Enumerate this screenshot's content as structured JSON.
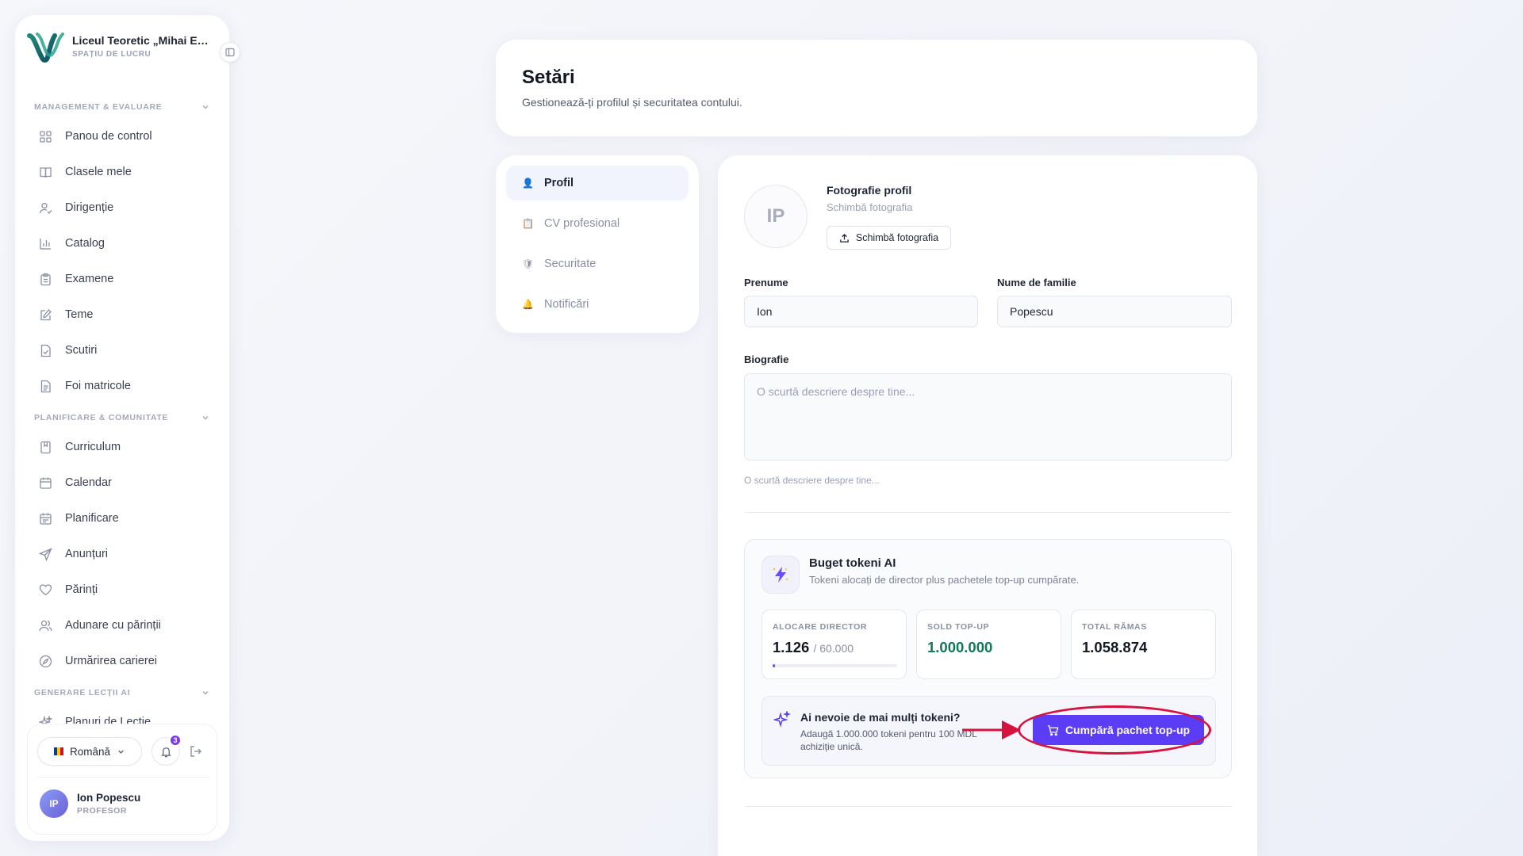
{
  "sidebar": {
    "school_name": "Liceul Teoretic „Mihai Emi...",
    "workspace_label": "SPAȚIU DE LUCRU",
    "sections": [
      {
        "label": "MANAGEMENT & EVALUARE"
      },
      {
        "label": "PLANIFICARE & COMUNITATE"
      },
      {
        "label": "GENERARE LECȚII AI"
      }
    ],
    "items": [
      {
        "label": "Panou de control",
        "icon": "grid-icon"
      },
      {
        "label": "Clasele mele",
        "icon": "book-icon"
      },
      {
        "label": "Dirigenție",
        "icon": "user-check-icon"
      },
      {
        "label": "Catalog",
        "icon": "bar-chart-icon"
      },
      {
        "label": "Examene",
        "icon": "clipboard-icon"
      },
      {
        "label": "Teme",
        "icon": "edit-icon"
      },
      {
        "label": "Scutiri",
        "icon": "file-check-icon"
      },
      {
        "label": "Foi matricole",
        "icon": "file-text-icon"
      },
      {
        "label": "Curriculum",
        "icon": "book-bookmark-icon"
      },
      {
        "label": "Calendar",
        "icon": "calendar-icon"
      },
      {
        "label": "Planificare",
        "icon": "calendar-list-icon"
      },
      {
        "label": "Anunțuri",
        "icon": "send-icon"
      },
      {
        "label": "Părinți",
        "icon": "heart-icon"
      },
      {
        "label": "Adunare cu părinții",
        "icon": "users-icon"
      },
      {
        "label": "Urmărirea carierei",
        "icon": "compass-icon"
      },
      {
        "label": "Planuri de Lecție",
        "icon": "sparkles-icon"
      }
    ],
    "language": "Română",
    "notification_count": "3",
    "user": {
      "initials": "IP",
      "name": "Ion Popescu",
      "role": "PROFESOR"
    }
  },
  "header": {
    "title": "Setări",
    "subtitle": "Gestionează-ți profilul și securitatea contului."
  },
  "settings_nav": [
    {
      "label": "Profil",
      "emoji": "👤",
      "active": true
    },
    {
      "label": "CV profesional",
      "emoji": "📋",
      "active": false
    },
    {
      "label": "Securitate",
      "emoji": "🛡",
      "active": false
    },
    {
      "label": "Notificări",
      "emoji": "🔔",
      "active": false
    }
  ],
  "profile": {
    "initials": "IP",
    "photo_title": "Fotografie profil",
    "photo_subtitle": "Schimbă fotografia",
    "photo_button": "Schimbă fotografia",
    "first_name_label": "Prenume",
    "first_name_value": "Ion",
    "last_name_label": "Nume de familie",
    "last_name_value": "Popescu",
    "bio_label": "Biografie",
    "bio_placeholder": "O scurtă descriere despre tine...",
    "bio_hint": "O scurtă descriere despre tine..."
  },
  "tokens": {
    "title": "Buget tokeni AI",
    "subtitle": "Tokeni alocați de director plus pachetele top-up cumpărate.",
    "stats": [
      {
        "label": "ALOCARE DIRECTOR",
        "value": "1.126",
        "of": "/ 60.000",
        "progress": 0.019
      },
      {
        "label": "SOLD TOP-UP",
        "value": "1.000.000"
      },
      {
        "label": "TOTAL RĂMAS",
        "value": "1.058.874"
      }
    ],
    "topup_title": "Ai nevoie de mai mulți tokeni?",
    "topup_desc": "Adaugă 1.000.000 tokeni pentru 100 MDL achiziție unică.",
    "buy_button": "Cumpără pachet top-up"
  },
  "colors": {
    "accent": "#5b3df5",
    "highlight": "#d8123e",
    "green": "#0f7a54"
  }
}
